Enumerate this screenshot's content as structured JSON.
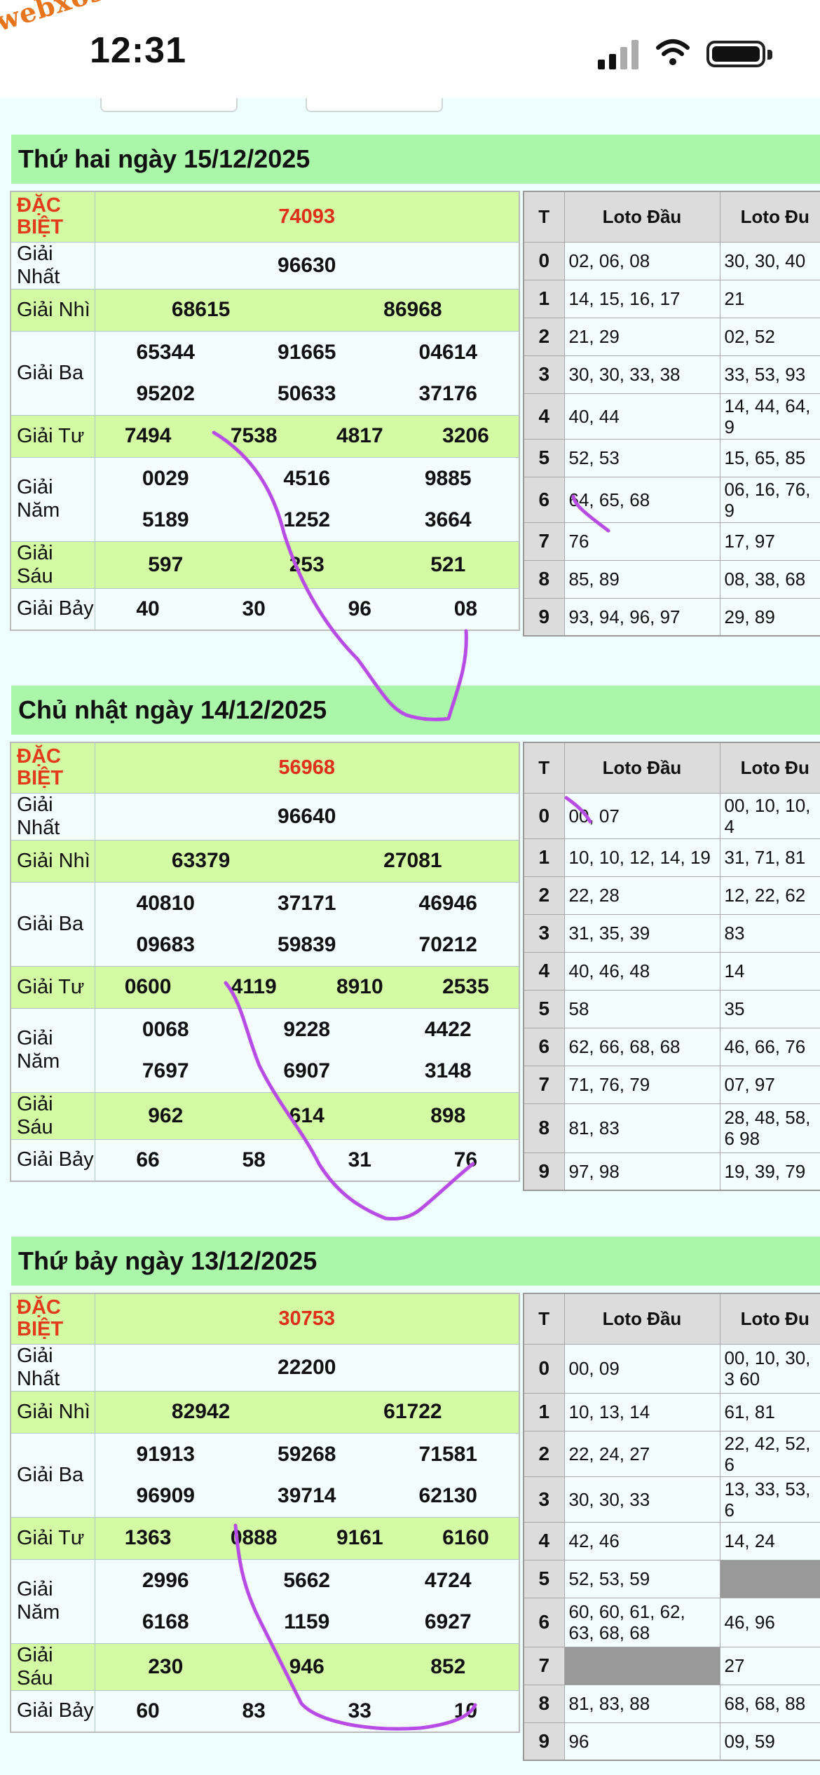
{
  "status_bar": {
    "watermark": "webxoso.net",
    "time": "12:31"
  },
  "sections": [
    {
      "title": "Thứ hai ngày 15/12/2025",
      "prizes": {
        "special_label": "ĐẶC BIỆT",
        "special": "74093",
        "first_label": "Giải Nhất",
        "first": [
          "96630"
        ],
        "second_label": "Giải Nhì",
        "second": [
          "68615",
          "86968"
        ],
        "third_label": "Giải Ba",
        "third": [
          [
            "65344",
            "91665",
            "04614"
          ],
          [
            "95202",
            "50633",
            "37176"
          ]
        ],
        "fourth_label": "Giải Tư",
        "fourth": [
          "7494",
          "7538",
          "4817",
          "3206"
        ],
        "fifth_label": "Giải Năm",
        "fifth": [
          [
            "0029",
            "4516",
            "9885"
          ],
          [
            "5189",
            "1252",
            "3664"
          ]
        ],
        "sixth_label": "Giải Sáu",
        "sixth": [
          "597",
          "253",
          "521"
        ],
        "seventh_label": "Giải Bảy",
        "seventh": [
          "40",
          "30",
          "96",
          "08"
        ]
      },
      "loto": {
        "head_t": "T",
        "head_dau": "Loto Đầu",
        "head_duoi": "Loto Đu",
        "rows": [
          {
            "t": "0",
            "dau": "02, 06, 08",
            "duoi": "30, 30, 40"
          },
          {
            "t": "1",
            "dau": "14, 15, 16, 17",
            "duoi": "21"
          },
          {
            "t": "2",
            "dau": "21, 29",
            "duoi": "02, 52"
          },
          {
            "t": "3",
            "dau": "30, 30, 33, 38",
            "duoi": "33, 53, 93"
          },
          {
            "t": "4",
            "dau": "40, 44",
            "duoi": "14, 44, 64, 9"
          },
          {
            "t": "5",
            "dau": "52, 53",
            "duoi": "15, 65, 85"
          },
          {
            "t": "6",
            "dau": "64, 65, 68",
            "duoi": "06, 16, 76, 9"
          },
          {
            "t": "7",
            "dau": "76",
            "duoi": "17, 97"
          },
          {
            "t": "8",
            "dau": "85, 89",
            "duoi": "08, 38, 68"
          },
          {
            "t": "9",
            "dau": "93, 94, 96, 97",
            "duoi": "29, 89"
          }
        ]
      }
    },
    {
      "title": "Chủ nhật ngày 14/12/2025",
      "prizes": {
        "special_label": "ĐẶC BIỆT",
        "special": "56968",
        "first_label": "Giải Nhất",
        "first": [
          "96640"
        ],
        "second_label": "Giải Nhì",
        "second": [
          "63379",
          "27081"
        ],
        "third_label": "Giải Ba",
        "third": [
          [
            "40810",
            "37171",
            "46946"
          ],
          [
            "09683",
            "59839",
            "70212"
          ]
        ],
        "fourth_label": "Giải Tư",
        "fourth": [
          "0600",
          "4119",
          "8910",
          "2535"
        ],
        "fifth_label": "Giải Năm",
        "fifth": [
          [
            "0068",
            "9228",
            "4422"
          ],
          [
            "7697",
            "6907",
            "3148"
          ]
        ],
        "sixth_label": "Giải Sáu",
        "sixth": [
          "962",
          "614",
          "898"
        ],
        "seventh_label": "Giải Bảy",
        "seventh": [
          "66",
          "58",
          "31",
          "76"
        ]
      },
      "loto": {
        "head_t": "T",
        "head_dau": "Loto Đầu",
        "head_duoi": "Loto Đu",
        "rows": [
          {
            "t": "0",
            "dau": "00, 07",
            "duoi": "00, 10, 10, 4"
          },
          {
            "t": "1",
            "dau": "10, 10, 12, 14, 19",
            "duoi": "31, 71, 81"
          },
          {
            "t": "2",
            "dau": "22, 28",
            "duoi": "12, 22, 62"
          },
          {
            "t": "3",
            "dau": "31, 35, 39",
            "duoi": "83"
          },
          {
            "t": "4",
            "dau": "40, 46, 48",
            "duoi": "14"
          },
          {
            "t": "5",
            "dau": "58",
            "duoi": "35"
          },
          {
            "t": "6",
            "dau": "62, 66, 68, 68",
            "duoi": "46, 66, 76"
          },
          {
            "t": "7",
            "dau": "71, 76, 79",
            "duoi": "07, 97"
          },
          {
            "t": "8",
            "dau": "81, 83",
            "duoi": "28, 48, 58, 6 98"
          },
          {
            "t": "9",
            "dau": "97, 98",
            "duoi": "19, 39, 79"
          }
        ]
      }
    },
    {
      "title": "Thứ bảy ngày 13/12/2025",
      "prizes": {
        "special_label": "ĐẶC BIỆT",
        "special": "30753",
        "first_label": "Giải Nhất",
        "first": [
          "22200"
        ],
        "second_label": "Giải Nhì",
        "second": [
          "82942",
          "61722"
        ],
        "third_label": "Giải Ba",
        "third": [
          [
            "91913",
            "59268",
            "71581"
          ],
          [
            "96909",
            "39714",
            "62130"
          ]
        ],
        "fourth_label": "Giải Tư",
        "fourth": [
          "1363",
          "0888",
          "9161",
          "6160"
        ],
        "fifth_label": "Giải Năm",
        "fifth": [
          [
            "2996",
            "5662",
            "4724"
          ],
          [
            "6168",
            "1159",
            "6927"
          ]
        ],
        "sixth_label": "Giải Sáu",
        "sixth": [
          "230",
          "946",
          "852"
        ],
        "seventh_label": "Giải Bảy",
        "seventh": [
          "60",
          "83",
          "33",
          "10"
        ]
      },
      "loto": {
        "head_t": "T",
        "head_dau": "Loto Đầu",
        "head_duoi": "Loto Đu",
        "rows": [
          {
            "t": "0",
            "dau": "00, 09",
            "duoi": "00, 10, 30, 3 60"
          },
          {
            "t": "1",
            "dau": "10, 13, 14",
            "duoi": "61, 81"
          },
          {
            "t": "2",
            "dau": "22, 24, 27",
            "duoi": "22, 42, 52, 6"
          },
          {
            "t": "3",
            "dau": "30, 30, 33",
            "duoi": "13, 33, 53, 6"
          },
          {
            "t": "4",
            "dau": "42, 46",
            "duoi": "14, 24"
          },
          {
            "t": "5",
            "dau": "52, 53, 59",
            "duoi": ""
          },
          {
            "t": "6",
            "dau": "60, 60, 61, 62, 63, 68, 68",
            "duoi": "46, 96"
          },
          {
            "t": "7",
            "dau": "",
            "duoi": "27"
          },
          {
            "t": "8",
            "dau": "81, 83, 88",
            "duoi": "68, 68, 88"
          },
          {
            "t": "9",
            "dau": "96",
            "duoi": "09, 59"
          }
        ]
      }
    }
  ]
}
